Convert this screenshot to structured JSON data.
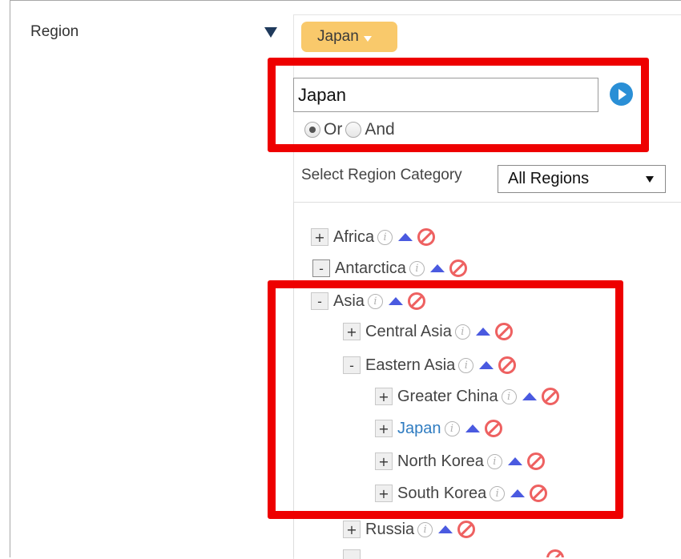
{
  "form": {
    "region_label": "Region",
    "selected_tag": "Japan"
  },
  "search": {
    "value": "Japan",
    "placeholder": ""
  },
  "match_mode": {
    "options": [
      "Or",
      "And"
    ],
    "selected": "Or"
  },
  "category": {
    "label": "Select Region Category",
    "selected": "All Regions"
  },
  "tree": {
    "nodes": [
      {
        "label": "Africa",
        "toggle": "+"
      },
      {
        "label": "Antarctica",
        "toggle": "-"
      },
      {
        "label": "Asia",
        "toggle": "-"
      },
      {
        "label": "Central Asia",
        "toggle": "+"
      },
      {
        "label": "Eastern Asia",
        "toggle": "-"
      },
      {
        "label": "Greater China",
        "toggle": "+"
      },
      {
        "label": "Japan",
        "toggle": "+"
      },
      {
        "label": "North Korea",
        "toggle": "+"
      },
      {
        "label": "South Korea",
        "toggle": "+"
      },
      {
        "label": "Russia",
        "toggle": "+"
      }
    ]
  },
  "icons": {
    "info": "info-icon",
    "move_up": "arrow-up-icon",
    "exclude": "no-entry-icon",
    "go": "play-circle-icon"
  },
  "colors": {
    "tag_bg": "#f9c96b",
    "highlight_border": "#ee0000",
    "link": "#2f7cc1",
    "move_up": "#4a5ae0",
    "exclude": "#ee6161",
    "go_button": "#2a8fd6"
  }
}
